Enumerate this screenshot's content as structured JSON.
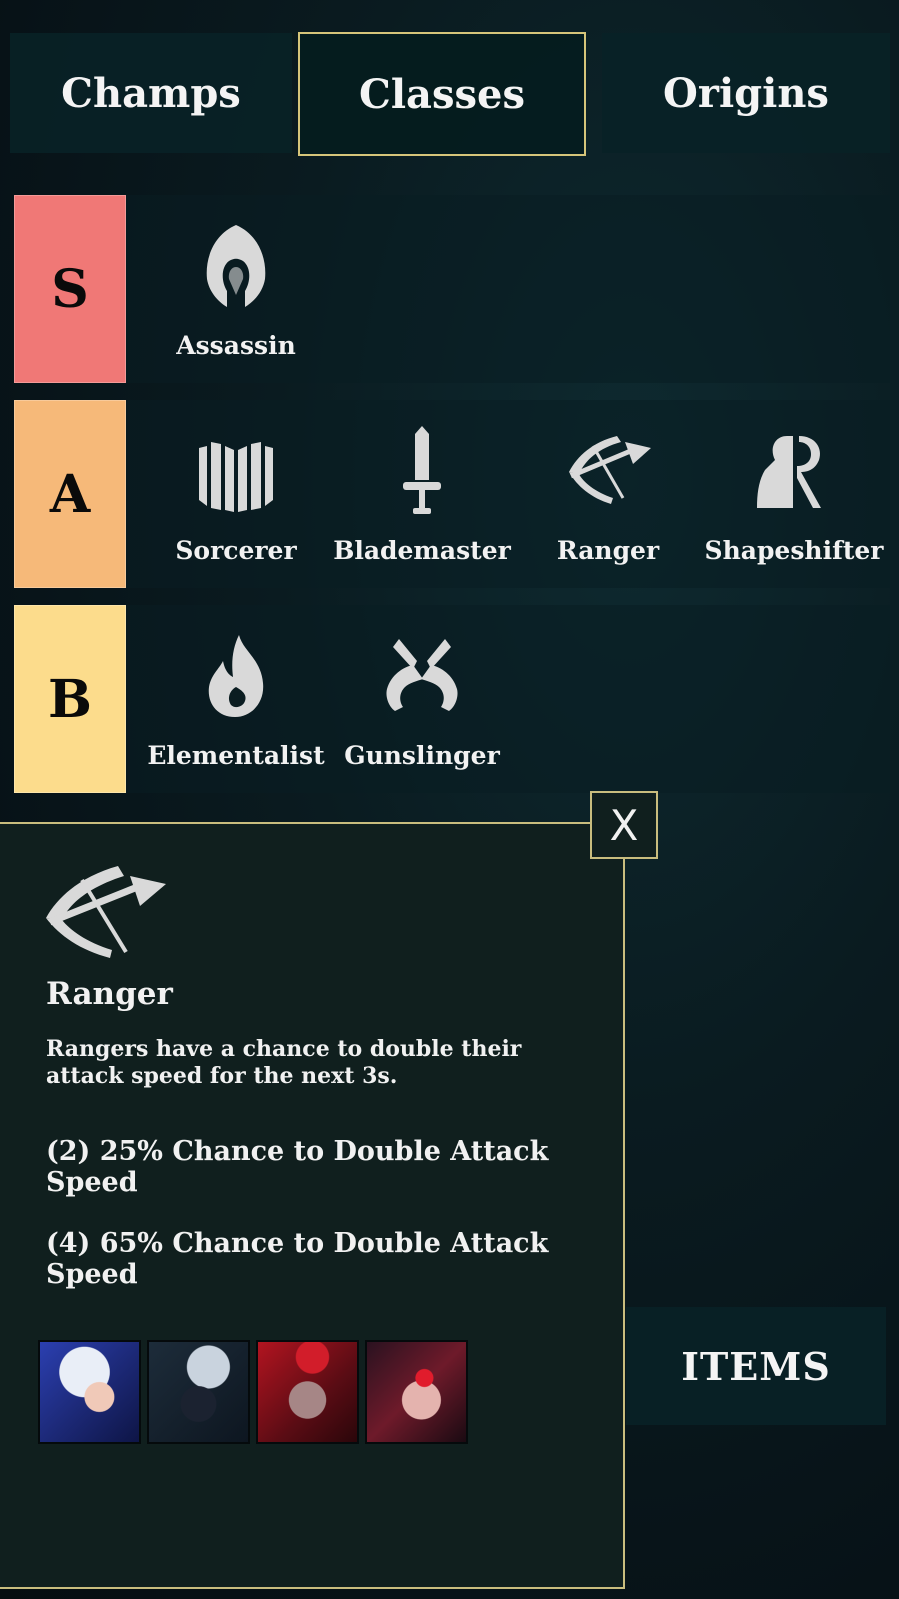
{
  "tabs": [
    {
      "label": "Champs"
    },
    {
      "label": "Classes"
    },
    {
      "label": "Origins"
    }
  ],
  "tiers": [
    {
      "label": "S",
      "color": "#f07876",
      "classes": [
        {
          "name": "Assassin",
          "icon": "hood-icon"
        }
      ]
    },
    {
      "label": "A",
      "color": "#f6b979",
      "classes": [
        {
          "name": "Sorcerer",
          "icon": "book-icon"
        },
        {
          "name": "Blademaster",
          "icon": "sword-icon"
        },
        {
          "name": "Ranger",
          "icon": "bow-icon"
        },
        {
          "name": "Shapeshifter",
          "icon": "shapeshifter-icon"
        }
      ]
    },
    {
      "label": "B",
      "color": "#fcdc8c",
      "classes": [
        {
          "name": "Elementalist",
          "icon": "flame-icon"
        },
        {
          "name": "Gunslinger",
          "icon": "crossed-pistols-icon"
        }
      ]
    }
  ],
  "popup": {
    "close_label": "X",
    "icon": "bow-icon",
    "title": "Ranger",
    "description": "Rangers have a chance to double their attack speed for the next 3s.",
    "bonuses": [
      "(2) 25% Chance to Double Attack Speed",
      "(4) 65% Chance to Double Attack Speed"
    ],
    "champions": [
      "champion-portrait-1",
      "champion-portrait-2",
      "champion-portrait-3",
      "champion-portrait-4"
    ]
  },
  "items_button": {
    "label": "ITEMS"
  },
  "colors": {
    "accent_border": "#c9bd7e",
    "panel_bg": "#101f1e",
    "icon_grey": "#d9d9d9"
  }
}
